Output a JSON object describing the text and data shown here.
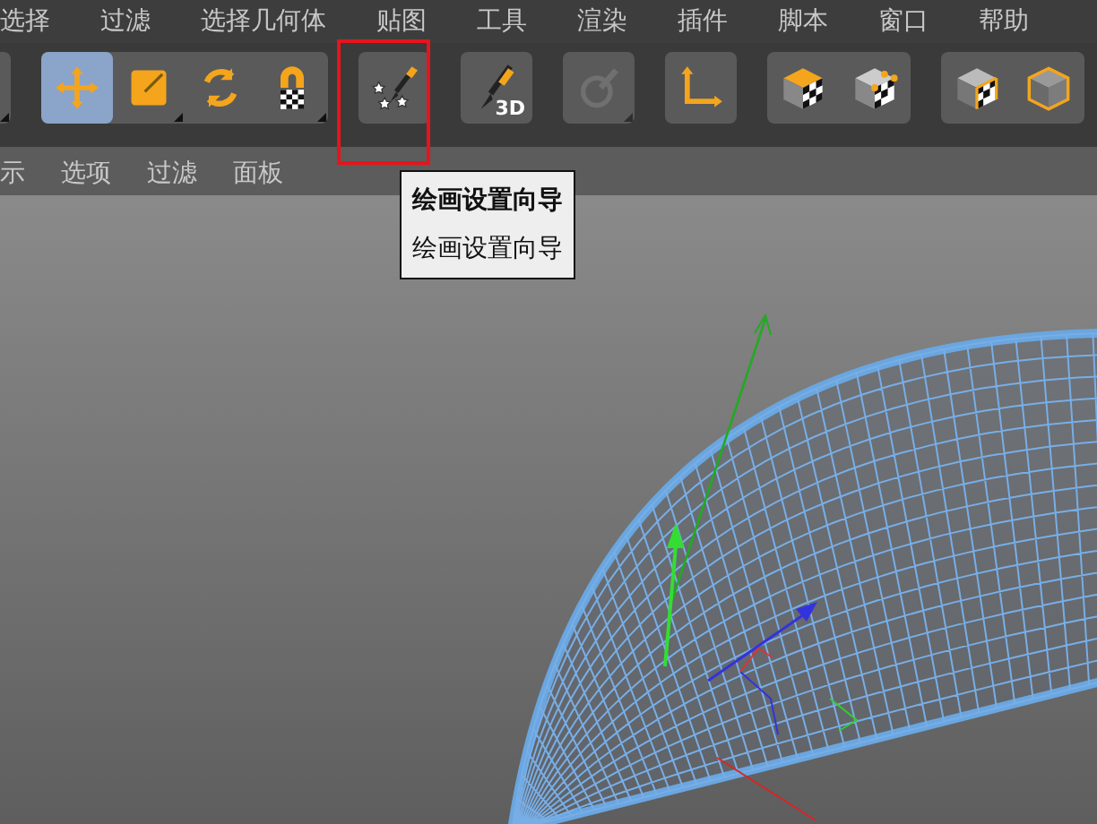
{
  "menu_bar": [
    {
      "label": "选择"
    },
    {
      "label": "过滤"
    },
    {
      "label": "选择几何体"
    },
    {
      "label": "贴图"
    },
    {
      "label": "工具"
    },
    {
      "label": "渲染"
    },
    {
      "label": "插件"
    },
    {
      "label": "脚本"
    },
    {
      "label": "窗口"
    },
    {
      "label": "帮助"
    }
  ],
  "toolbar": [
    {
      "tools": [
        {
          "kind": "partial",
          "selected": false,
          "disabled": false,
          "submenu": true,
          "highlighted": false
        }
      ]
    },
    {
      "tools": [
        {
          "kind": "move",
          "selected": true,
          "disabled": false,
          "submenu": false,
          "highlighted": false
        },
        {
          "kind": "scale",
          "selected": false,
          "disabled": false,
          "submenu": true,
          "highlighted": false
        },
        {
          "kind": "rotate",
          "selected": false,
          "disabled": false,
          "submenu": false,
          "highlighted": false
        },
        {
          "kind": "snap",
          "selected": false,
          "disabled": false,
          "submenu": true,
          "highlighted": false
        }
      ]
    },
    {
      "tools": [
        {
          "kind": "paint-wizard",
          "selected": false,
          "disabled": false,
          "submenu": false,
          "highlighted": true
        }
      ]
    },
    {
      "tools": [
        {
          "kind": "paint-3d",
          "label": "3D",
          "selected": false,
          "disabled": false,
          "submenu": false,
          "highlighted": false
        }
      ]
    },
    {
      "tools": [
        {
          "kind": "sculpt",
          "selected": false,
          "disabled": true,
          "submenu": true,
          "highlighted": false
        }
      ]
    },
    {
      "tools": [
        {
          "kind": "axis",
          "selected": false,
          "disabled": false,
          "submenu": false,
          "highlighted": false
        }
      ]
    },
    {
      "tools": [
        {
          "kind": "cube-checker",
          "selected": false,
          "disabled": false,
          "submenu": false,
          "highlighted": false
        },
        {
          "kind": "cube-points",
          "selected": false,
          "disabled": false,
          "submenu": false,
          "highlighted": false
        }
      ]
    },
    {
      "tools": [
        {
          "kind": "cube-edges",
          "selected": false,
          "disabled": false,
          "submenu": false,
          "highlighted": false
        },
        {
          "kind": "cube-outline",
          "selected": false,
          "disabled": false,
          "submenu": false,
          "highlighted": false
        }
      ]
    }
  ],
  "tooltip": {
    "title": "绘画设置向导",
    "text": "绘画设置向导"
  },
  "viewport_menu": [
    {
      "label": "示"
    },
    {
      "label": "选项"
    },
    {
      "label": "过滤"
    },
    {
      "label": "面板"
    }
  ]
}
